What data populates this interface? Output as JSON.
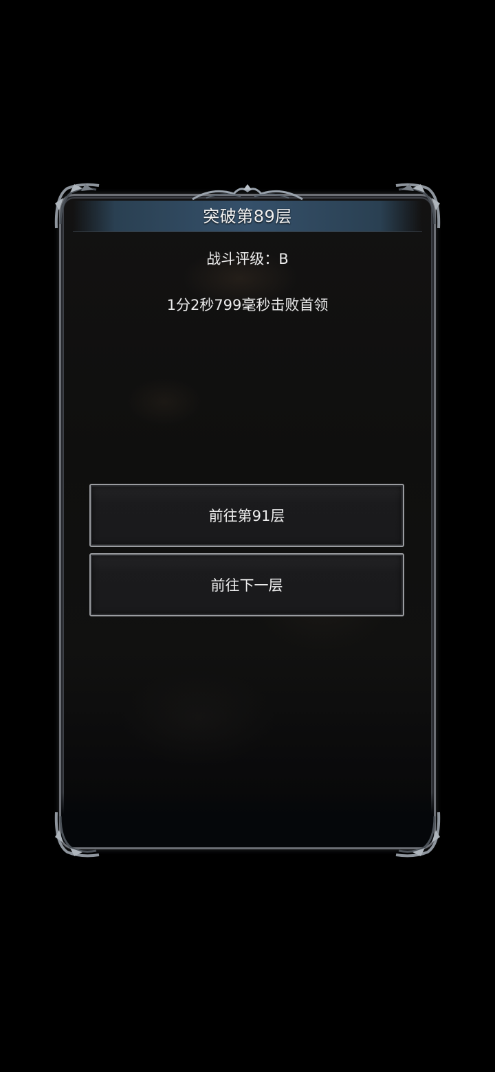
{
  "dialog": {
    "title": "突破第89层",
    "rating": "战斗评级：B",
    "result": "1分2秒799毫秒击败首领",
    "buttons": {
      "goto_floor": "前往第91层",
      "next_floor": "前往下一层"
    }
  },
  "colors": {
    "background": "#000000",
    "panel": "#111110",
    "frame": "#6c6f75",
    "title_banner": "#35506a",
    "button_border": "#9a9ca0",
    "text": "#ececec"
  }
}
